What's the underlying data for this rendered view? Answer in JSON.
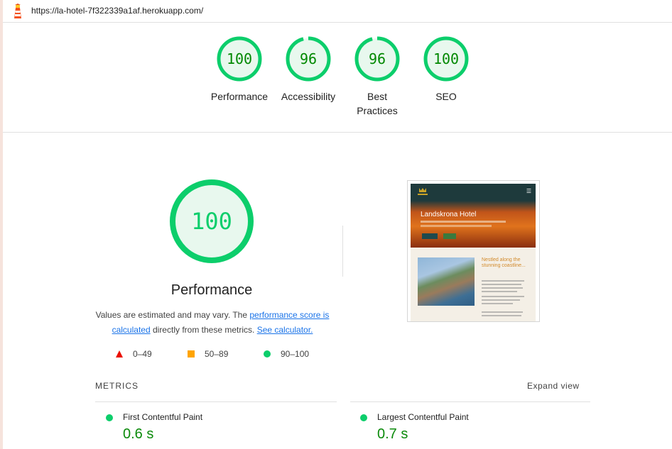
{
  "page": {
    "url": "https://la-hotel-7f322339a1af.herokuapp.com/"
  },
  "gauges": [
    {
      "score": "100",
      "label": "Performance",
      "fraction": 1.0
    },
    {
      "score": "96",
      "label": "Accessibility",
      "fraction": 0.96
    },
    {
      "score": "96",
      "label": "Best Practices",
      "fraction": 0.96
    },
    {
      "score": "100",
      "label": "SEO",
      "fraction": 1.0
    }
  ],
  "performance": {
    "score": "100",
    "title": "Performance",
    "desc_prefix": "Values are estimated and may vary. The ",
    "desc_link1": "performance score is calculated",
    "desc_mid": " directly from these metrics. ",
    "desc_link2": "See calculator."
  },
  "legend": [
    {
      "range": "0–49",
      "shape": "triangle",
      "color": "#eb0f00"
    },
    {
      "range": "50–89",
      "shape": "square",
      "color": "#ffa400"
    },
    {
      "range": "90–100",
      "shape": "circle",
      "color": "#0cce6b"
    }
  ],
  "screenshot": {
    "hero_title": "Landskrona Hotel",
    "section_heading": "Nestled along the stunning coastline..."
  },
  "metrics": {
    "header": "METRICS",
    "expand_label": "Expand view",
    "items": [
      {
        "name": "First Contentful Paint",
        "value": "0.6 s"
      },
      {
        "name": "Largest Contentful Paint",
        "value": "0.7 s"
      }
    ]
  },
  "colors": {
    "pass": "#0cce6b",
    "pass_text": "#008800",
    "pass_bg": "#e8f8ee"
  }
}
